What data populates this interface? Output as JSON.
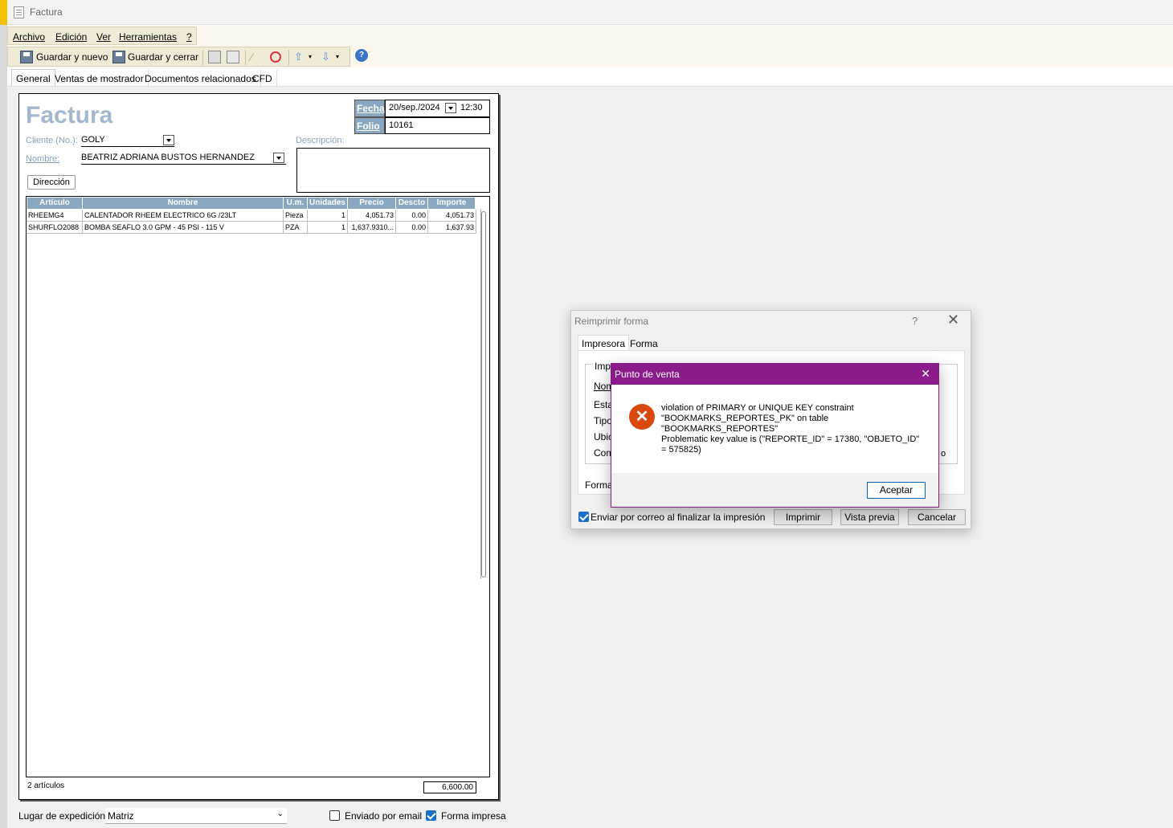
{
  "window": {
    "title": "Factura"
  },
  "menu": [
    "Archivo",
    "Edición",
    "Ver",
    "Herramientas",
    "?"
  ],
  "toolbar": {
    "save_new": "Guardar y nuevo",
    "save_close": "Guardar y cerrar"
  },
  "tabs": [
    "General",
    "Ventas de mostrador",
    "Documentos relacionados",
    "CFD"
  ],
  "form": {
    "title": "Factura",
    "fecha_label": "Fecha",
    "fecha_value": "20/sep./2024",
    "hora_value": "12:30",
    "folio_label": "Folio",
    "folio_value": "10161",
    "cliente_label": "Cliente (No.):",
    "cliente_value": "GOLY",
    "nombre_label": "Nombre:",
    "nombre_value": "BEATRIZ ADRIANA BUSTOS HERNANDEZ",
    "descripcion_label": "Descripción:",
    "direccion_button": "Dirección"
  },
  "grid": {
    "headers": [
      "Artículo",
      "Nombre",
      "U.m.",
      "Unidades",
      "Precio",
      "Descto",
      "Importe"
    ],
    "rows": [
      {
        "articulo": "RHEEMG4",
        "nombre": "CALENTADOR RHEEM ELECTRICO 6G /23LT",
        "um": "Pieza",
        "unidades": "1",
        "precio": "4,051.73",
        "descto": "0.00",
        "importe": "4,051.73"
      },
      {
        "articulo": "SHURFLO2088",
        "nombre": "BOMBA SEAFLO 3.0 GPM - 45 PSI - 115 V",
        "um": "PZA",
        "unidades": "1",
        "precio": "1,637.9310...",
        "descto": "0.00",
        "importe": "1,637.93"
      }
    ],
    "count_label": "2 artículos",
    "total": "6,600.00"
  },
  "bottom": {
    "lugar_label": "Lugar de expedición:",
    "lugar_value": "Matriz",
    "enviado_label": "Enviado por email",
    "enviado_checked": false,
    "forma_impresa_label": "Forma impresa",
    "forma_impresa_checked": true
  },
  "reimprimir": {
    "title": "Reimprimir forma",
    "help": "?",
    "tabs": [
      "Impresora",
      "Forma"
    ],
    "group_label": "Impr",
    "labels": [
      "Nom",
      "Esta",
      "Tipo",
      "Ubica",
      "Com"
    ],
    "right_fragment": "o",
    "forma_label": "Forma:",
    "email_checkbox": "Enviar por correo al finalizar la impresión",
    "email_checked": true,
    "buttons": [
      "Imprimir",
      "Vista previa",
      "Cancelar"
    ]
  },
  "msgbox": {
    "title": "Punto de venta",
    "lines": [
      "violation of PRIMARY or UNIQUE KEY constraint",
      "\"BOOKMARKS_REPORTES_PK\" on table",
      "\"BOOKMARKS_REPORTES\"",
      "Problematic key value is (\"REPORTE_ID\" = 17380, \"OBJETO_ID\"",
      "= 575825)"
    ],
    "ok": "Aceptar"
  },
  "colors": {
    "accent_purple": "#8b1a8b",
    "header_blue": "#8aa7c2",
    "error_red": "#d9480f"
  }
}
